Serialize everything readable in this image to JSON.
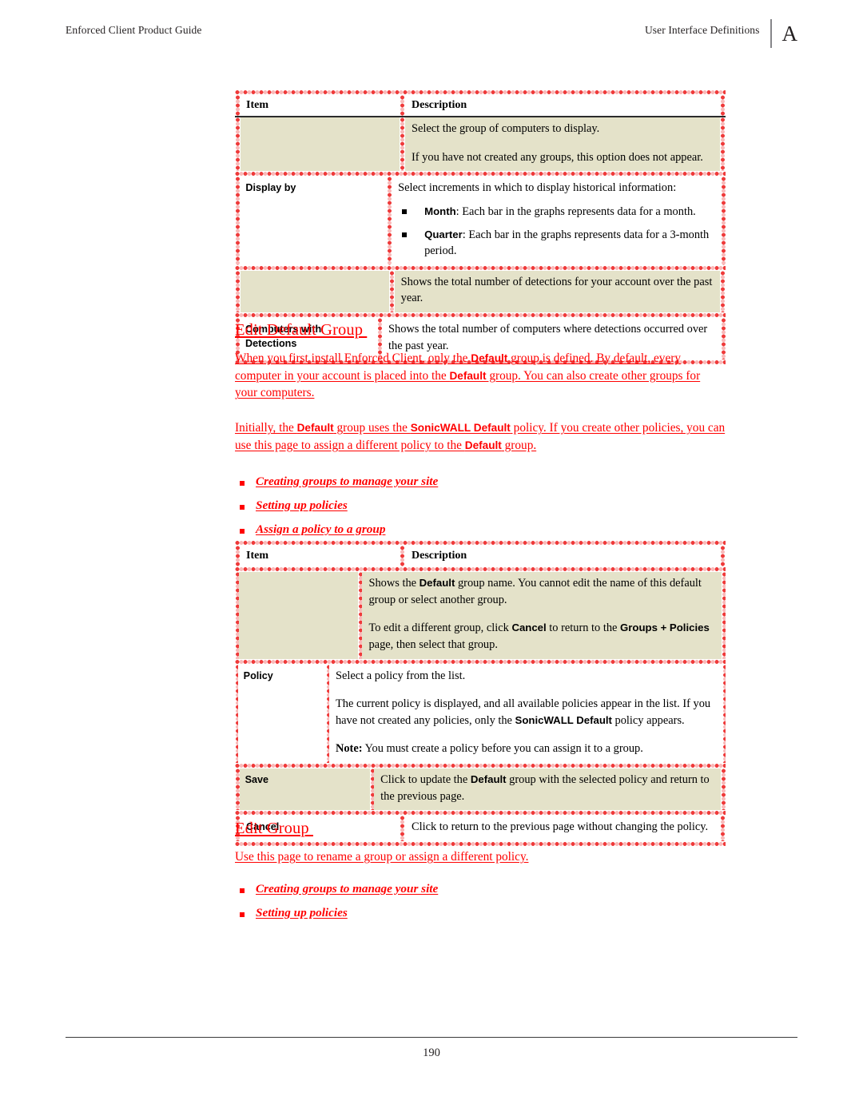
{
  "header": {
    "left_title": "Enforced Client Product Guide",
    "right_title": "User Interface Definitions",
    "appendix_letter": "A"
  },
  "footer": {
    "page_number": "190"
  },
  "table_one": {
    "columns": [
      "Item",
      "Description"
    ],
    "rows": [
      {
        "item": "",
        "shaded": true,
        "paragraphs": [
          "Select the group of computers to display.",
          "If you have not created any groups, this option does not appear."
        ]
      },
      {
        "item": "Display by",
        "shaded": false,
        "paragraphs": [
          "Select increments in which to display historical information:"
        ],
        "bullets": [
          {
            "term": "Month",
            "text": ": Each bar in the graphs represents data for a month."
          },
          {
            "term": "Quarter",
            "text": ": Each bar in the graphs represents data for a 3-month period."
          }
        ]
      },
      {
        "item": "",
        "shaded": true,
        "paragraphs": [
          "Shows the total number of detections for your account over the past year."
        ]
      },
      {
        "item": "Computers with Detections",
        "shaded": false,
        "paragraphs": [
          "Shows the total number of computers where detections occurred over the past year."
        ]
      }
    ]
  },
  "section_edit_default_group": {
    "heading": "Edit Default Group ",
    "para1_a": "When you first install Enforced Client, only the ",
    "para1_b1": "Default",
    "para1_c": " group is defined. By default, every computer in your account is placed into the ",
    "para1_b2": "Default",
    "para1_d": " group. You can also create other groups for your computers. ",
    "para2_a": "Initially, the ",
    "para2_b1": "Default",
    "para2_c": " group uses the ",
    "para2_b2": "SonicWALL Default",
    "para2_d": " policy. If you create other policies, you can use this page to assign a different policy to the ",
    "para2_b3": "Default",
    "para2_e": " group. ",
    "links": [
      "Creating groups to manage your site",
      "Setting up policies",
      "Assign a policy to a group"
    ]
  },
  "table_two": {
    "columns": [
      "Item",
      "Description"
    ],
    "rows": [
      {
        "item": "",
        "shaded": true,
        "p1_a": "Shows the ",
        "p1_b": "Default",
        "p1_c": " group name. You cannot edit the name of this default group or select another group.",
        "p2_a": "To edit a different group, click ",
        "p2_b1": "Cancel",
        "p2_c": " to return to the ",
        "p2_b2": "Groups + Policies",
        "p2_d": " page, then select that group."
      },
      {
        "item": "Policy",
        "shaded": false,
        "p1": "Select a policy from the list.",
        "p2_a": "The current policy is displayed, and all available policies appear in the list. If you have not created any policies, only the ",
        "p2_b": "SonicWALL Default",
        "p2_c": " policy appears.",
        "p3_note": "Note:",
        "p3_text": " You must create a policy before you can assign it to a group."
      },
      {
        "item": "Save",
        "shaded": true,
        "p1_a": "Click to update the ",
        "p1_b": "Default",
        "p1_c": " group with the selected policy and return to the previous page."
      },
      {
        "item": "Cancel",
        "shaded": false,
        "p1_a": "Click to return to the previous page without changing the policy."
      }
    ]
  },
  "section_edit_group": {
    "heading": "Edit Group ",
    "para1": "Use this page to rename a group or assign a different policy. ",
    "links": [
      "Creating groups to manage your site",
      "Setting up policies"
    ]
  },
  "colors": {
    "link_red": "#ff0000",
    "shade_beige": "#e4e2c9",
    "hatch_red": "#ef3b3b",
    "text_black": "#000000"
  }
}
